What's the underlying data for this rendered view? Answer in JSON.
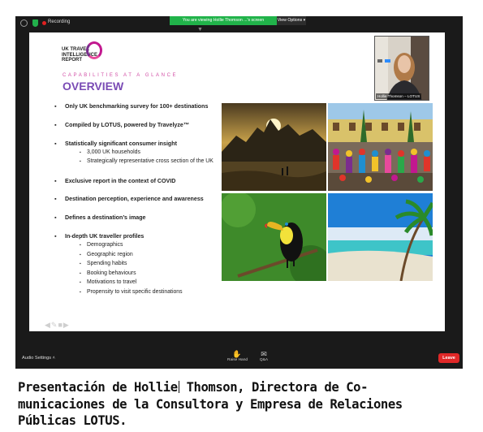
{
  "window": {
    "recording_label": "Recording",
    "viewing_banner": "You are viewing Hollie Thomson ...'s screen",
    "view_options_label": "View Options ▾"
  },
  "slide": {
    "logo_lines": [
      "UK TRAVEL",
      "INTELLIGENCE",
      "REPORT"
    ],
    "kicker": "CAPABILITIES AT A GLANCE",
    "title": "OVERVIEW",
    "bullets": [
      "Only UK benchmarking survey for 100+ destinations",
      "Compiled by LOTUS, powered by Travelyze™",
      "Statistically significant consumer insight",
      "3,000 UK households",
      "Strategically representative cross section of the UK",
      "Exclusive report in the context of COVID",
      "Destination perception, experience and awareness",
      "Defines a destination’s image",
      "In-depth UK traveller profiles",
      "Demographics",
      "Geographic region",
      "Spending habits",
      "Booking behaviours",
      "Motivations to travel",
      "Propensity to visit specific destinations"
    ],
    "photos": [
      "rio-sunset",
      "festival-dancers",
      "toucan",
      "tropical-beach"
    ]
  },
  "participant": {
    "name": "Hollie Thomson – LOTUS"
  },
  "toolbar": {
    "audio_settings": "Audio Settings  ˄",
    "raise_hand": "Raise Hand",
    "qa": "Q&A",
    "leave": "Leave"
  },
  "caption": {
    "line1_a": "Presentación de Hollie",
    "line1_b": " Thomson, Directora de Co-",
    "line2": "municaciones de la Consultora y Empresa de Relaciones",
    "line3": "Públicas LOTUS."
  }
}
